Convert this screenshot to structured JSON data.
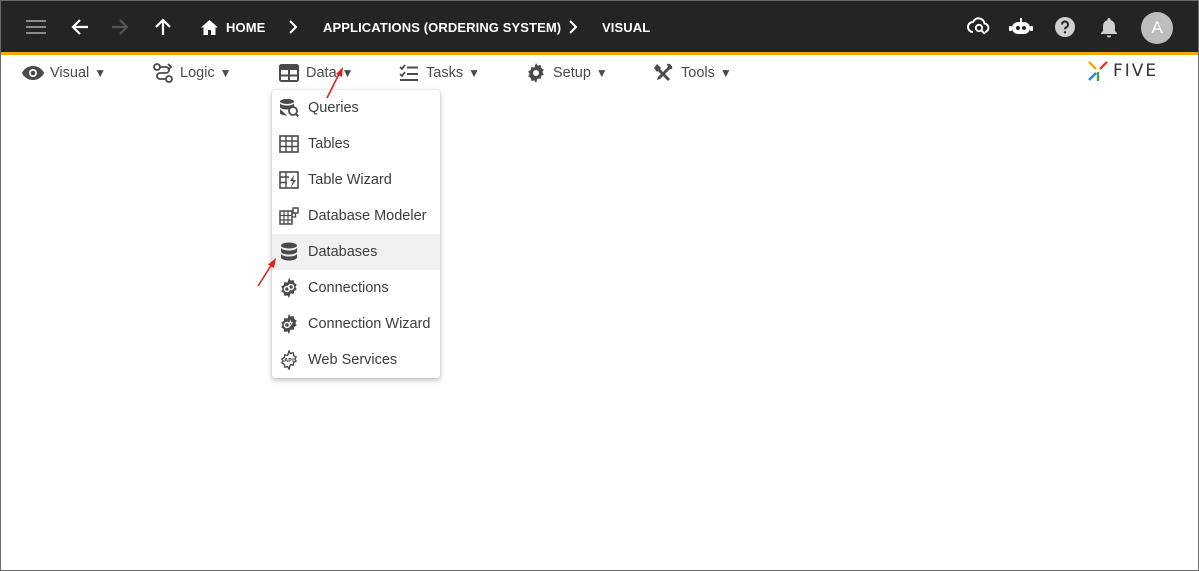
{
  "topbar": {
    "menu_icon": "hamburger-icon",
    "back_icon": "arrow-left-icon",
    "forward_icon": "arrow-right-icon",
    "up_icon": "arrow-up-icon",
    "breadcrumbs": [
      {
        "label": "HOME",
        "icon": "home-icon"
      },
      {
        "label": "APPLICATIONS (ORDERING SYSTEM)"
      },
      {
        "label": "VISUAL"
      }
    ],
    "right_icons": [
      "cloud-search-icon",
      "chatbot-icon",
      "help-icon",
      "bell-icon"
    ],
    "avatar_letter": "A",
    "bar_color": "#242424",
    "accent_color": "#f2a900"
  },
  "menubar": {
    "items": [
      {
        "label": "Visual",
        "icon": "eye-icon"
      },
      {
        "label": "Logic",
        "icon": "logic-flow-icon"
      },
      {
        "label": "Data",
        "icon": "table-grid-icon"
      },
      {
        "label": "Tasks",
        "icon": "checklist-icon"
      },
      {
        "label": "Setup",
        "icon": "gear-icon"
      },
      {
        "label": "Tools",
        "icon": "tools-icon"
      }
    ],
    "caret": "▼"
  },
  "logo": {
    "text": "FIVE"
  },
  "dropdown": {
    "items": [
      {
        "label": "Queries",
        "icon": "database-search-icon"
      },
      {
        "label": "Tables",
        "icon": "table-icon"
      },
      {
        "label": "Table Wizard",
        "icon": "table-wizard-icon"
      },
      {
        "label": "Database Modeler",
        "icon": "database-modeler-icon"
      },
      {
        "label": "Databases",
        "icon": "database-icon",
        "highlighted": true
      },
      {
        "label": "Connections",
        "icon": "connection-icon"
      },
      {
        "label": "Connection Wizard",
        "icon": "connection-wizard-icon"
      },
      {
        "label": "Web Services",
        "icon": "api-gear-icon"
      }
    ]
  },
  "annotation_color": "#e02020"
}
